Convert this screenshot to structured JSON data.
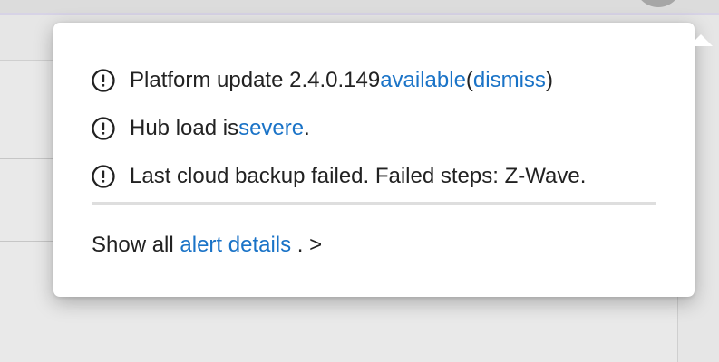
{
  "alerts": [
    {
      "icon": "exclamation-circle-icon",
      "text_before": "Platform update 2.4.0.149 ",
      "link": "available",
      "text_mid": " (",
      "link2": "dismiss",
      "text_after": ")"
    },
    {
      "icon": "exclamation-circle-icon",
      "text_before": "Hub load is ",
      "link": "severe",
      "text_after": "."
    },
    {
      "icon": "exclamation-circle-icon",
      "text_before": "Last cloud backup failed. Failed steps: Z-Wave."
    }
  ],
  "footer": {
    "text_before": "Show all ",
    "link": "alert details",
    "text_after": ". >"
  },
  "colors": {
    "link": "#1a73c7",
    "text": "#222222",
    "popover_bg": "#ffffff"
  }
}
